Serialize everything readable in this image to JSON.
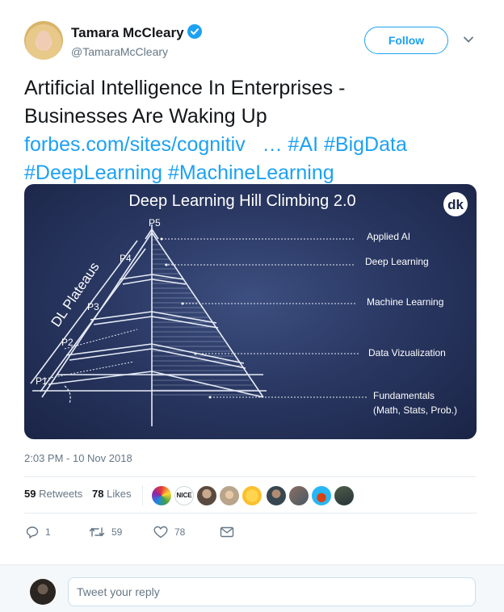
{
  "author": {
    "name": "Tamara McCleary",
    "handle": "@TamaraMcCleary",
    "verified": true
  },
  "follow_label": "Follow",
  "tweet": {
    "text_line1": "Artificial Intelligence In Enterprises -",
    "text_line2": "Businesses Are Waking Up",
    "link": "forbes.com/sites/cognitiv",
    "ellipsis": "…",
    "hashtags": [
      "#AI",
      "#BigData",
      "#DeepLearning",
      "#MachineLearning"
    ]
  },
  "media": {
    "title": "Deep Learning Hill Climbing 2.0",
    "logo": "dk",
    "side_label": "DL Plateaus",
    "points": [
      "P5",
      "P4",
      "P3",
      "P2",
      "P1"
    ],
    "levels": [
      "Applied AI",
      "Deep Learning",
      "Machine Learning",
      "Data Vizualization",
      "Fundamentals",
      "(Math, Stats, Prob.)"
    ]
  },
  "timestamp": "2:03 PM - 10 Nov 2018",
  "stats": {
    "retweets_count": "59",
    "retweets_label": "Retweets",
    "likes_count": "78",
    "likes_label": "Likes",
    "nice_badge": "NICE"
  },
  "actions": {
    "reply_count": "1",
    "retweet_count": "59",
    "like_count": "78"
  },
  "reply": {
    "placeholder": "Tweet your reply"
  },
  "colors": {
    "accent": "#1da1f2",
    "text": "#14171a",
    "muted": "#657786"
  },
  "icons": [
    "verified-badge-icon",
    "chevron-down-icon",
    "reply-icon",
    "retweet-icon",
    "like-icon",
    "dm-icon"
  ]
}
